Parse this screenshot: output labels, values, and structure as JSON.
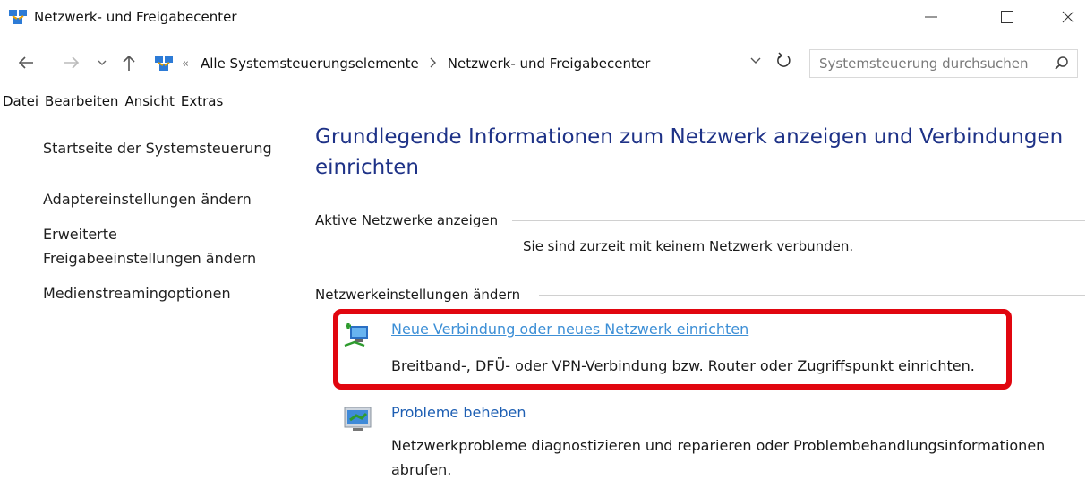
{
  "window": {
    "title": "Netzwerk- und Freigabecenter",
    "minimize_glyph": "—",
    "maximize_glyph": "☐",
    "close_glyph": "✕"
  },
  "nav": {
    "back_icon": "arrow-left-icon",
    "forward_icon": "arrow-right-icon",
    "recent_icon": "chevron-down-icon",
    "up_icon": "arrow-up-icon",
    "breadcrumb_sep": "«",
    "breadcrumbs": [
      "Alle Systemsteuerungselemente",
      "Netzwerk- und Freigabecenter"
    ],
    "search_placeholder": "Systemsteuerung durchsuchen"
  },
  "menu": [
    "Datei",
    "Bearbeiten",
    "Ansicht",
    "Extras"
  ],
  "sidebar": {
    "links": [
      "Startseite der Systemsteuerung",
      "Adaptereinstellungen ändern",
      "Erweiterte",
      "Freigabeeinstellungen ändern",
      "Medienstreamingoptionen"
    ]
  },
  "main": {
    "heading_line1": "Grundlegende Informationen zum Netzwerk anzeigen und Verbindungen",
    "heading_line2": "einrichten",
    "active_section": "Aktive Netzwerke anzeigen",
    "active_status": "Sie sind zurzeit mit keinem Netzwerk verbunden.",
    "settings_section": "Netzwerkeinstellungen ändern",
    "tasks": [
      {
        "title": "Neue Verbindung oder neues Netzwerk einrichten",
        "desc": "Breitband-, DFÜ- oder VPN-Verbindung bzw. Router oder Zugriffspunkt einrichten."
      },
      {
        "title": "Probleme beheben",
        "desc_line1": "Netzwerkprobleme diagnostizieren und reparieren oder Problembehandlungsinformationen",
        "desc_line2": "abrufen."
      }
    ]
  },
  "colors": {
    "heading": "#1e3287",
    "link": "#1e5fb3",
    "link_highlight": "#3d8fd6",
    "annotation": "#e1060f"
  }
}
